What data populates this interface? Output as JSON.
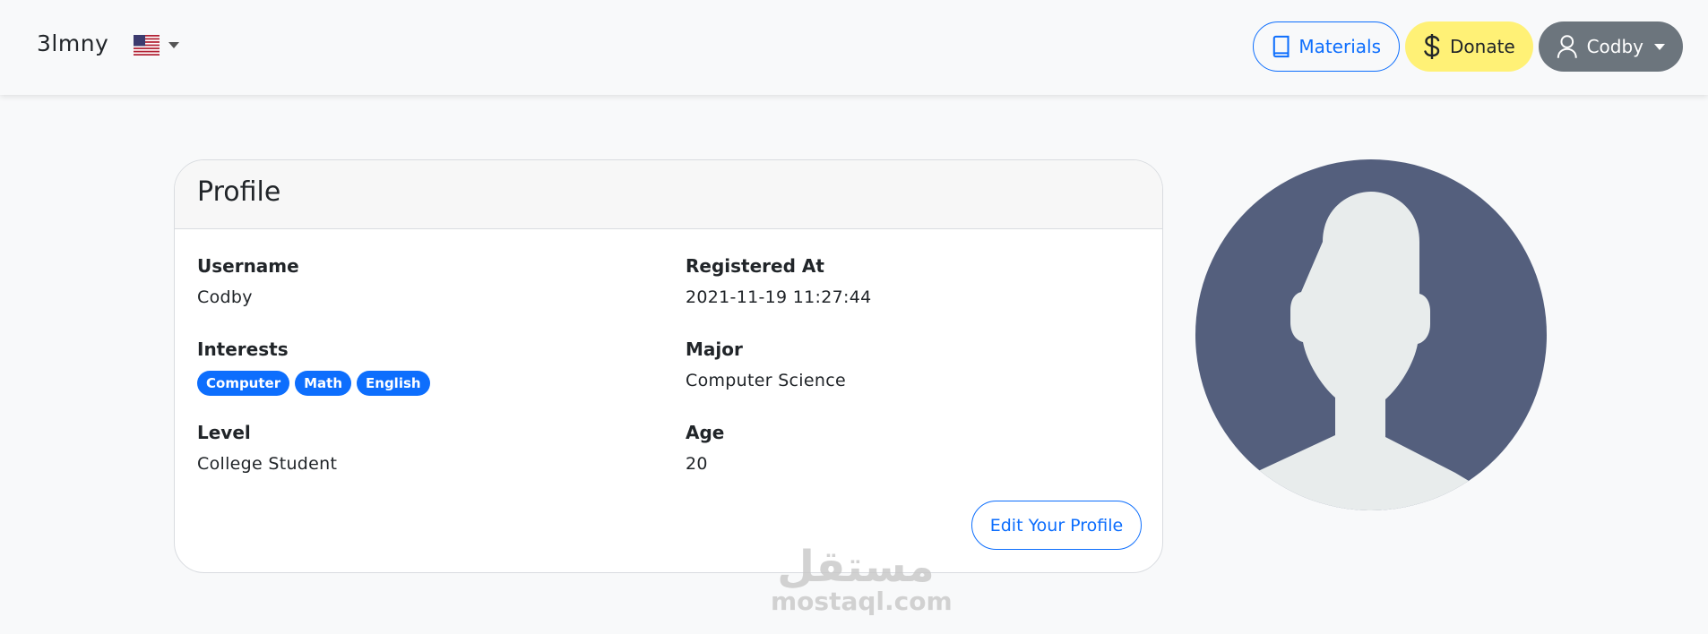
{
  "nav": {
    "brand": "3lmny",
    "language_icon": "us-flag-icon",
    "materials_label": "Materials",
    "donate_label": "Donate",
    "user_label": "Codby"
  },
  "profile": {
    "title": "Profile",
    "fields": {
      "username": {
        "label": "Username",
        "value": "Codby"
      },
      "registered": {
        "label": "Registered At",
        "value": "2021-11-19 11:27:44"
      },
      "interests": {
        "label": "Interests",
        "tags": [
          "Computer",
          "Math",
          "English"
        ]
      },
      "major": {
        "label": "Major",
        "value": "Computer Science"
      },
      "level": {
        "label": "Level",
        "value": "College Student"
      },
      "age": {
        "label": "Age",
        "value": "20"
      }
    },
    "edit_label": "Edit Your Profile"
  },
  "watermark": {
    "arabic": "مستقل",
    "latin": "mostaql.com"
  },
  "colors": {
    "primary": "#0d6efd",
    "donate": "#fff176",
    "user_button": "#6c757d",
    "avatar_bg": "#545f7d",
    "avatar_figure": "#e8ecec"
  }
}
